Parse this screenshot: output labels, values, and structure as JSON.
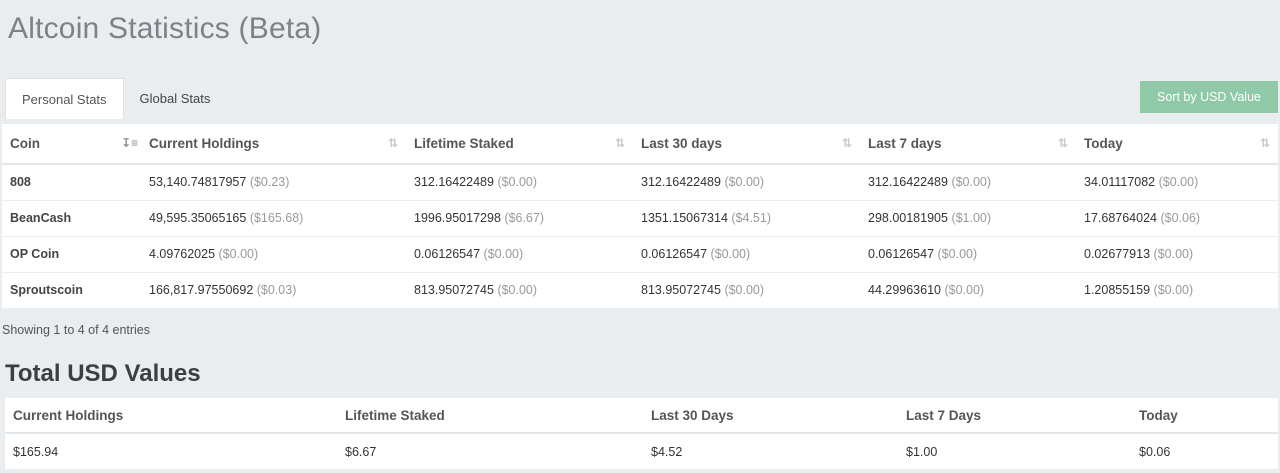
{
  "page": {
    "title": "Altcoin Statistics (Beta)"
  },
  "tabs": [
    {
      "label": "Personal Stats",
      "active": true
    },
    {
      "label": "Global Stats",
      "active": false
    }
  ],
  "sort_button": "Sort by USD Value",
  "stats": {
    "columns": [
      "Coin",
      "Current Holdings",
      "Lifetime Staked",
      "Last 30 days",
      "Last 7 days",
      "Today"
    ],
    "rows": [
      {
        "coin": "808",
        "cells": [
          [
            "53,140.74817957",
            "($0.23)"
          ],
          [
            "312.16422489",
            "($0.00)"
          ],
          [
            "312.16422489",
            "($0.00)"
          ],
          [
            "312.16422489",
            "($0.00)"
          ],
          [
            "34.01117082",
            "($0.00)"
          ]
        ]
      },
      {
        "coin": "BeanCash",
        "cells": [
          [
            "49,595.35065165",
            "($165.68)"
          ],
          [
            "1996.95017298",
            "($6.67)"
          ],
          [
            "1351.15067314",
            "($4.51)"
          ],
          [
            "298.00181905",
            "($1.00)"
          ],
          [
            "17.68764024",
            "($0.06)"
          ]
        ]
      },
      {
        "coin": "OP Coin",
        "cells": [
          [
            "4.09762025",
            "($0.00)"
          ],
          [
            "0.06126547",
            "($0.00)"
          ],
          [
            "0.06126547",
            "($0.00)"
          ],
          [
            "0.06126547",
            "($0.00)"
          ],
          [
            "0.02677913",
            "($0.00)"
          ]
        ]
      },
      {
        "coin": "Sproutscoin",
        "cells": [
          [
            "166,817.97550692",
            "($0.03)"
          ],
          [
            "813.95072745",
            "($0.00)"
          ],
          [
            "813.95072745",
            "($0.00)"
          ],
          [
            "44.29963610",
            "($0.00)"
          ],
          [
            "1.20855159",
            "($0.00)"
          ]
        ]
      }
    ],
    "sort_icons": {
      "active": "sort-amount-desc-icon",
      "inactive": "sort-icon"
    }
  },
  "showing": "Showing 1 to 4 of 4 entries",
  "totals": {
    "title": "Total USD Values",
    "columns": [
      "Current Holdings",
      "Lifetime Staked",
      "Last 30 Days",
      "Last 7 Days",
      "Today"
    ],
    "values": [
      "$165.94",
      "$6.67",
      "$4.52",
      "$1.00",
      "$0.06"
    ]
  }
}
